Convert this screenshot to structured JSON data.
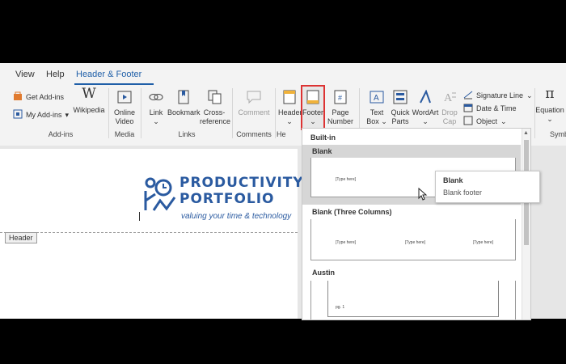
{
  "tabs": [
    {
      "label": "View"
    },
    {
      "label": "Help"
    },
    {
      "label": "Header & Footer"
    }
  ],
  "ribbon": {
    "addins": {
      "get_addins": "Get Add-ins",
      "my_addins": "My Add-ins",
      "wikipedia": "Wikipedia",
      "group_label": "Add-ins"
    },
    "media": {
      "online_video_line1": "Online",
      "online_video_line2": "Video",
      "group_label": "Media"
    },
    "links": {
      "link": "Link",
      "bookmark": "Bookmark",
      "cross_ref_line1": "Cross-",
      "cross_ref_line2": "reference",
      "group_label": "Links"
    },
    "comments": {
      "comment": "Comment",
      "group_label": "Comments"
    },
    "header_footer": {
      "header": "Header",
      "footer": "Footer",
      "page_number_line1": "Page",
      "page_number_line2": "Number",
      "group_label": "He"
    },
    "text": {
      "text_box_line1": "Text",
      "text_box_line2": "Box",
      "quick_parts_line1": "Quick",
      "quick_parts_line2": "Parts",
      "wordart": "WordArt",
      "drop_cap_line1": "Drop",
      "drop_cap_line2": "Cap",
      "signature_line": "Signature Line",
      "date_time": "Date & Time",
      "object": "Object"
    },
    "symbols": {
      "equation": "Equation",
      "group_label": "Symb"
    }
  },
  "document": {
    "logo_line1": "PRODUCTIVITY",
    "logo_line2": "PORTFOLIO",
    "logo_tagline": "valuing your time & technology",
    "header_tag": "Header"
  },
  "dropdown": {
    "section_title": "Built-in",
    "items": [
      {
        "label": "Blank",
        "placeholders": [
          "[Type here]"
        ]
      },
      {
        "label": "Blank (Three Columns)",
        "placeholders": [
          "[Type here]",
          "[Type here]",
          "[Type here]"
        ]
      },
      {
        "label": "Austin",
        "placeholders": [
          "pg. 1"
        ]
      }
    ]
  },
  "tooltip": {
    "title": "Blank",
    "description": "Blank footer"
  },
  "colors": {
    "accent": "#1f5fa8",
    "highlight_outline": "#d33333",
    "logo_blue": "#2a5aa0"
  }
}
